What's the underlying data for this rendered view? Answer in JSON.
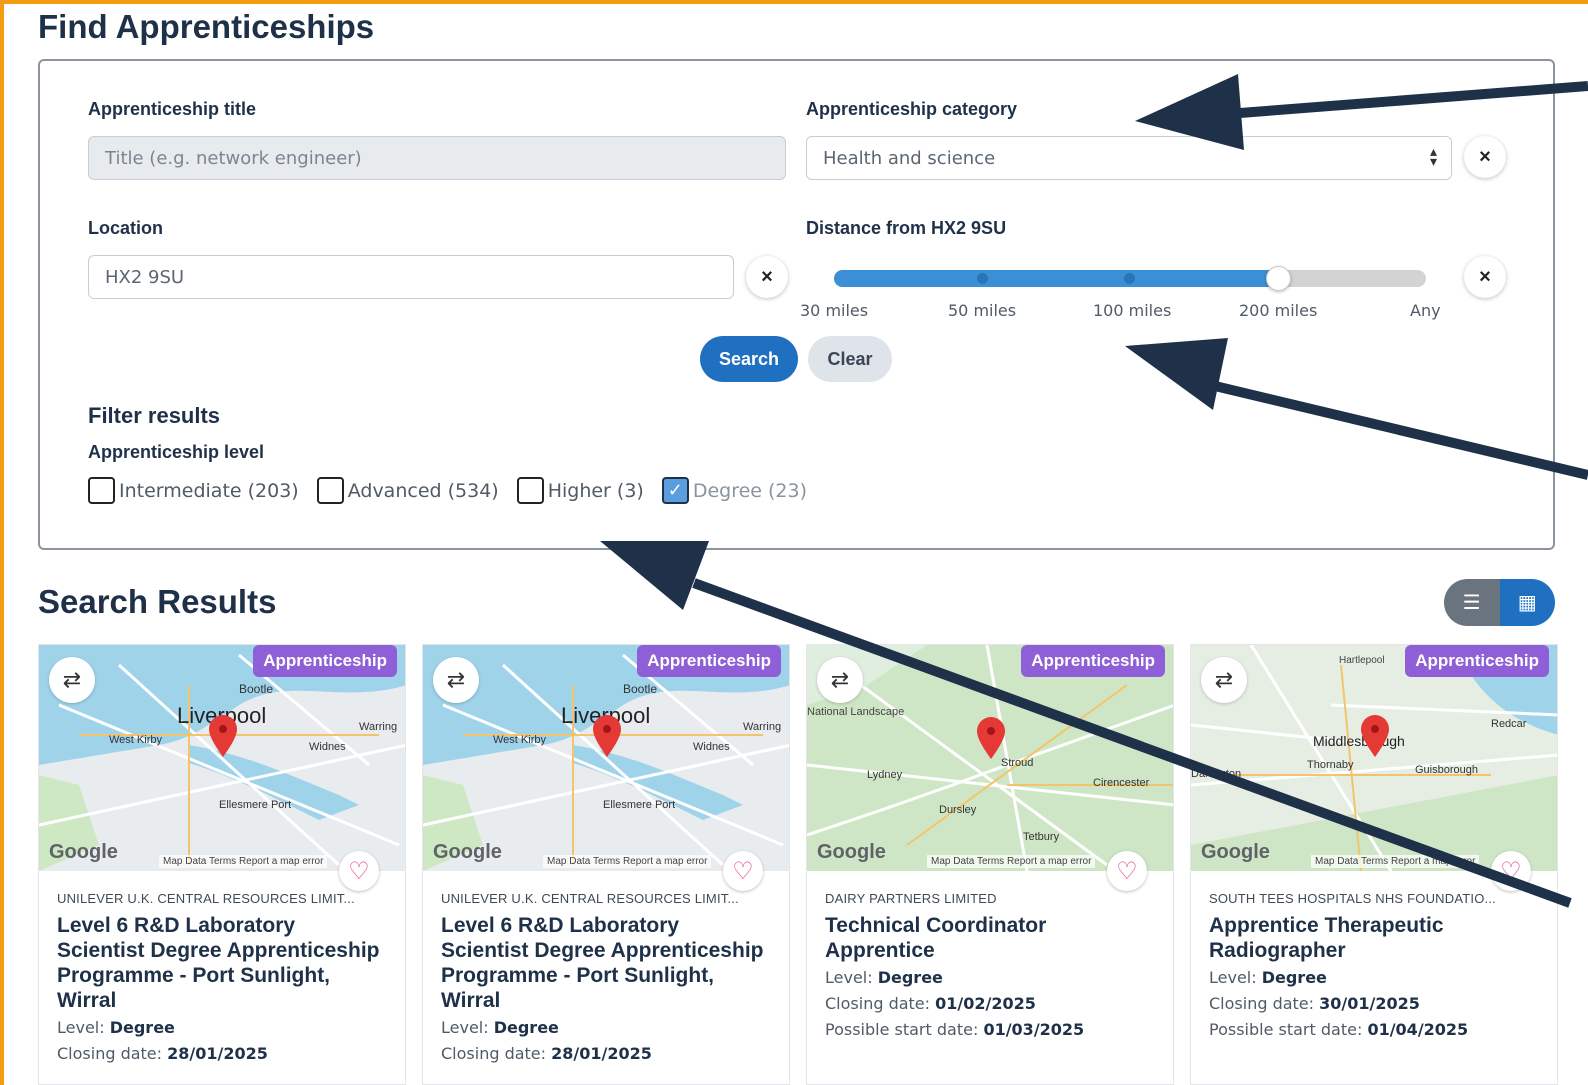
{
  "page": {
    "title": "Find Apprenticeships"
  },
  "search": {
    "title_label": "Apprenticeship title",
    "title_placeholder": "Title (e.g. network engineer)",
    "category_label": "Apprenticeship category",
    "category_value": "Health and science",
    "location_label": "Location",
    "location_value": "HX2 9SU",
    "distance_label": "Distance from HX2 9SU",
    "distance_ticks": [
      "30 miles",
      "50 miles",
      "100 miles",
      "200 miles",
      "Any"
    ],
    "distance_selected": "200 miles",
    "search_label": "Search",
    "clear_label": "Clear",
    "clear_icon": "×"
  },
  "filters": {
    "title": "Filter results",
    "level_label": "Apprenticeship level",
    "levels": [
      {
        "label": "Intermediate (203)",
        "checked": false
      },
      {
        "label": "Advanced (534)",
        "checked": false
      },
      {
        "label": "Higher (3)",
        "checked": false
      },
      {
        "label": "Degree (23)",
        "checked": true
      }
    ]
  },
  "results": {
    "title": "Search Results",
    "view_icons": [
      "list-icon",
      "grid-icon"
    ],
    "cards": [
      {
        "badge": "Apprenticeship",
        "map_labels": [
          "Bootle",
          "Liverpool",
          "West Kirby",
          "Widnes",
          "Warring",
          "Ellesmere Port"
        ],
        "employer": "UNILEVER U.K. CENTRAL RESOURCES LIMIT...",
        "title": "Level 6 R&D Laboratory Scientist Degree Apprenticeship Programme - Port Sunlight, Wirral",
        "level_label": "Level:",
        "level": "Degree",
        "closing_label": "Closing date:",
        "closing": "28/01/2025"
      },
      {
        "badge": "Apprenticeship",
        "map_labels": [
          "Bootle",
          "Liverpool",
          "West Kirby",
          "Widnes",
          "Warring",
          "Ellesmere Port"
        ],
        "employer": "UNILEVER U.K. CENTRAL RESOURCES LIMIT...",
        "title": "Level 6 R&D Laboratory Scientist Degree Apprenticeship Programme - Port Sunlight, Wirral",
        "level_label": "Level:",
        "level": "Degree",
        "closing_label": "Closing date:",
        "closing": "28/01/2025"
      },
      {
        "badge": "Apprenticeship",
        "map_labels": [
          "National Landscape",
          "Lydney",
          "Stroud",
          "Cirencester",
          "Dursley",
          "Tetbury"
        ],
        "employer": "DAIRY PARTNERS LIMITED",
        "title": "Technical Coordinator Apprentice",
        "level_label": "Level:",
        "level": "Degree",
        "closing_label": "Closing date:",
        "closing": "01/02/2025",
        "start_label": "Possible start date:",
        "start": "01/03/2025"
      },
      {
        "badge": "Apprenticeship",
        "map_labels": [
          "Hartlepool",
          "Redcar",
          "Middlesbrough",
          "Thornaby",
          "Guisborough",
          "Darlington"
        ],
        "employer": "SOUTH TEES HOSPITALS NHS FOUNDATIO...",
        "title": "Apprentice Therapeutic Radiographer",
        "level_label": "Level:",
        "level": "Degree",
        "closing_label": "Closing date:",
        "closing": "30/01/2025",
        "start_label": "Possible start date:",
        "start": "01/04/2025"
      }
    ],
    "map_brand": "Google",
    "map_attribution": "Map Data  Terms  Report a map error"
  },
  "colors": {
    "accent_border": "#f39c12",
    "primary": "#1f70c1",
    "badge": "#8e5fd6",
    "heading": "#1f3149",
    "arrow": "#1f3149"
  }
}
